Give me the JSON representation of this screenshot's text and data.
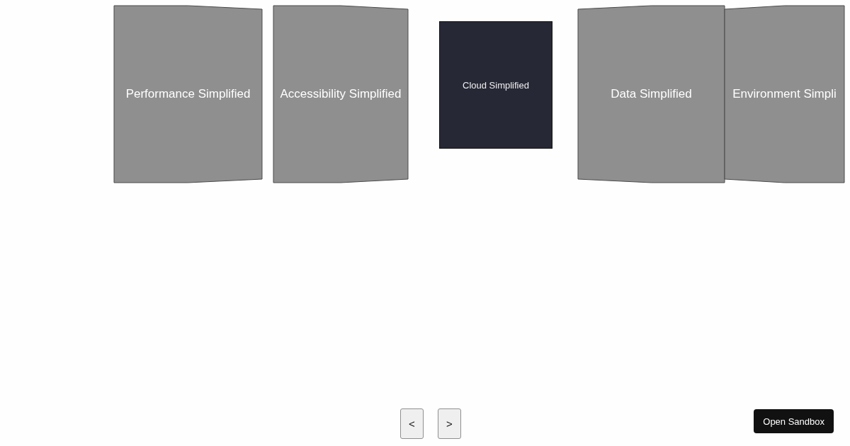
{
  "carousel": {
    "cards": [
      {
        "title": "Performance Simplified",
        "selected": false
      },
      {
        "title": "Accessibility Simplified",
        "selected": false
      },
      {
        "title": "Cloud Simplified",
        "selected": true
      },
      {
        "title": "Data Simplified",
        "selected": false
      },
      {
        "title": "Environment Simpli",
        "selected": false
      }
    ]
  },
  "controls": {
    "previous": "<",
    "next": ">"
  },
  "sandbox_button": {
    "label": "Open Sandbox"
  }
}
